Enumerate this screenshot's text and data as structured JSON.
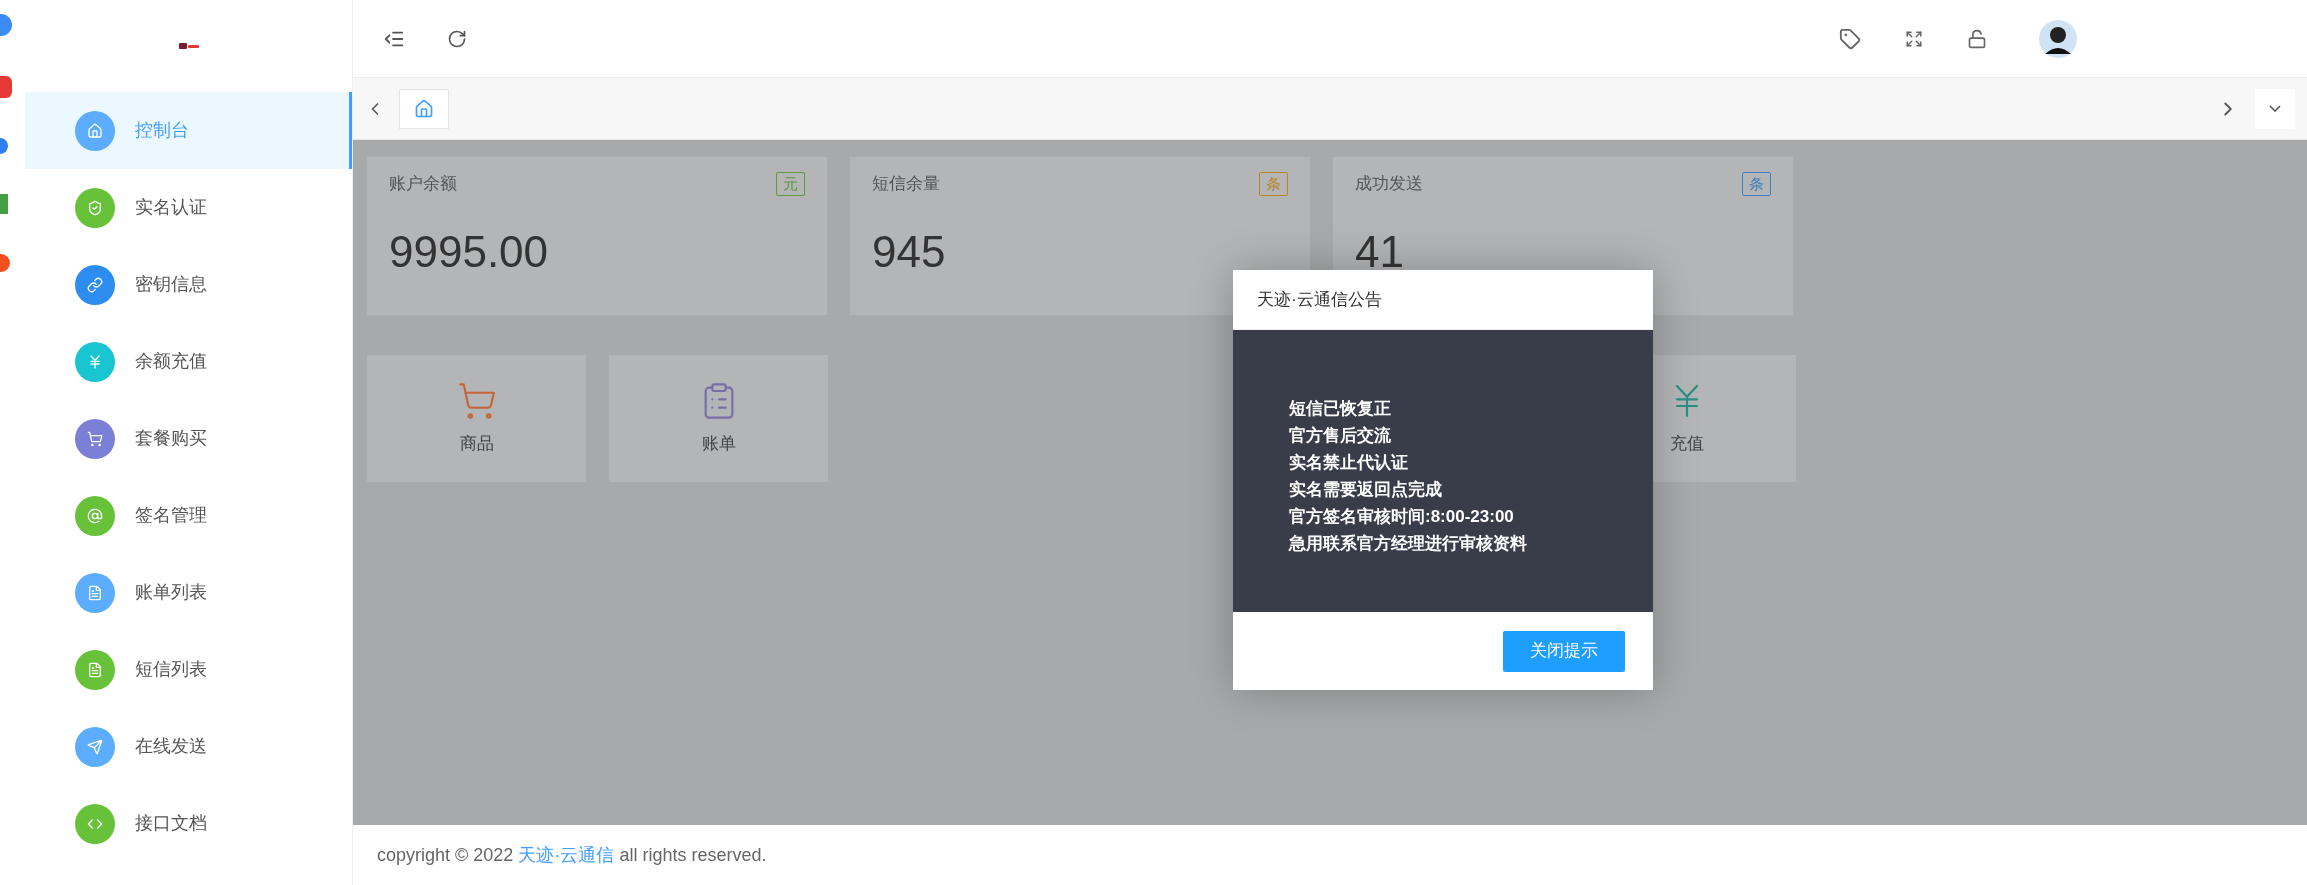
{
  "sidebar": {
    "items": [
      {
        "label": "控制台",
        "color": "#5cadff",
        "selected": true
      },
      {
        "label": "实名认证",
        "color": "#67c23a",
        "selected": false
      },
      {
        "label": "密钥信息",
        "color": "#2d8cf0",
        "selected": false
      },
      {
        "label": "余额充值",
        "color": "#19c5d0",
        "selected": false
      },
      {
        "label": "套餐购买",
        "color": "#7b7fd6",
        "selected": false
      },
      {
        "label": "签名管理",
        "color": "#67c23a",
        "selected": false
      },
      {
        "label": "账单列表",
        "color": "#5cadff",
        "selected": false
      },
      {
        "label": "短信列表",
        "color": "#67c23a",
        "selected": false
      },
      {
        "label": "在线发送",
        "color": "#5cadff",
        "selected": false
      },
      {
        "label": "接口文档",
        "color": "#67c23a",
        "selected": false
      }
    ]
  },
  "stats": [
    {
      "title": "账户余额",
      "badge": "元",
      "color": "#5f9a3a",
      "value": "9995.00"
    },
    {
      "title": "短信余量",
      "badge": "条",
      "color": "#b5862f",
      "value": "945"
    },
    {
      "title": "成功发送",
      "badge": "条",
      "color": "#3f7fc0",
      "value": "41"
    }
  ],
  "shortcuts": [
    {
      "label": "商品",
      "color": "#c8643a"
    },
    {
      "label": "账单",
      "color": "#7a6ea8"
    },
    {
      "label": "充值",
      "color": "#2a8f82"
    }
  ],
  "dialog": {
    "title": "天迹·云通信公告",
    "lines": [
      "短信已恢复正",
      "官方售后交流",
      "实名禁止代认证",
      "实名需要返回点完成",
      "官方签名审核时间:8:00-23:00",
      "急用联系官方经理进行审核资料"
    ],
    "button": "关闭提示"
  },
  "footer": {
    "before": "copyright © 2022",
    "link": "天迹·云通信",
    "after": "all rights reserved."
  }
}
